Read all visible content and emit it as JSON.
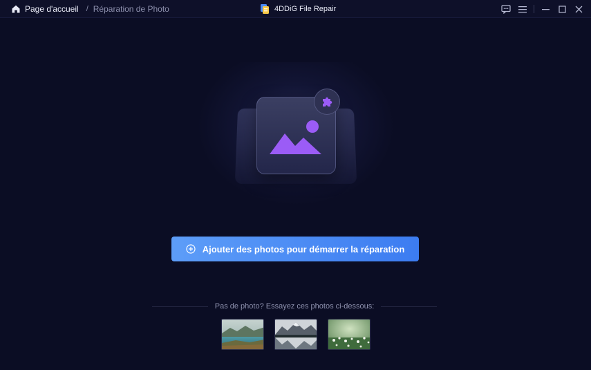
{
  "titlebar": {
    "home_label": "Page d'accueil",
    "separator": "/",
    "current_label": "Réparation de Photo",
    "app_name": "4DDiG File Repair"
  },
  "main": {
    "add_button_label": "Ajouter des photos pour démarrer la réparation"
  },
  "samples": {
    "label": "Pas de photo? Essayez ces photos ci-dessous:",
    "items": [
      {
        "name": "sample-lake"
      },
      {
        "name": "sample-mountain-reflection"
      },
      {
        "name": "sample-meadow"
      }
    ]
  },
  "colors": {
    "background": "#0b0d24",
    "accent": "#4a8af5",
    "illustration": "#9b5cf6"
  }
}
